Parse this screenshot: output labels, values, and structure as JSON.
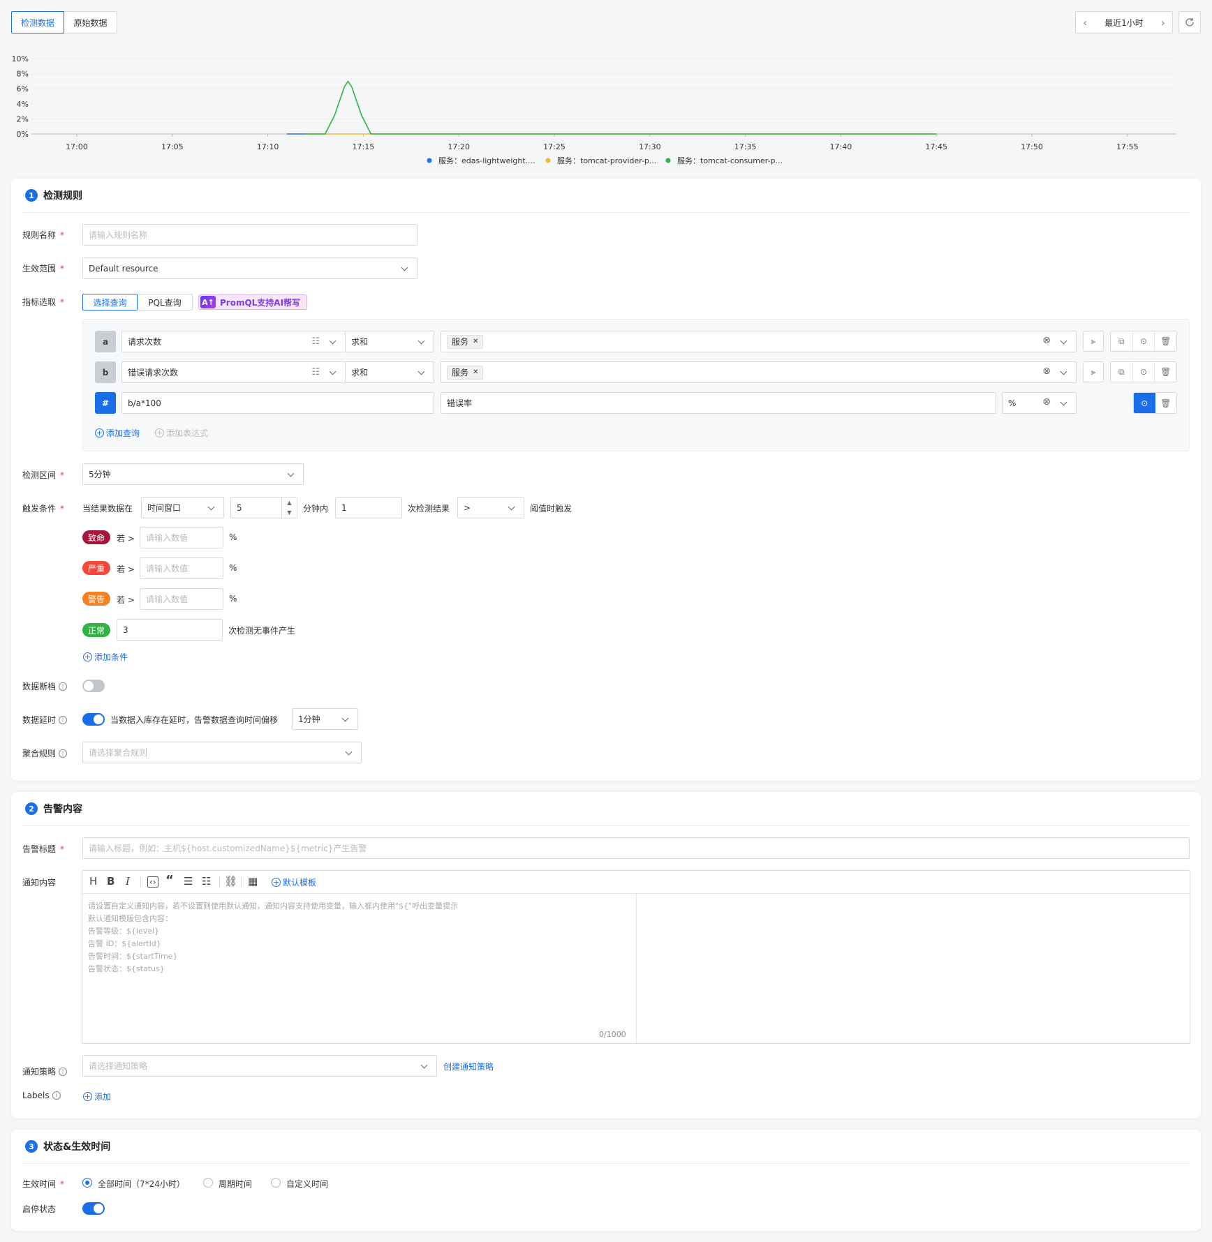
{
  "tabs": {
    "detect": "检测数据",
    "raw": "原始数据"
  },
  "timeRange": {
    "label": "最近1小时",
    "prev": "‹",
    "next": "›"
  },
  "chart_data": {
    "type": "line",
    "x": [
      "17:00",
      "17:05",
      "17:10",
      "17:15",
      "17:20",
      "17:25",
      "17:30",
      "17:35",
      "17:40",
      "17:45",
      "17:50",
      "17:55"
    ],
    "yticks": [
      "10%",
      "8%",
      "6%",
      "4%",
      "2%",
      "0%"
    ],
    "ylim": [
      0,
      10
    ],
    "series": [
      {
        "name": "服务：edas-lightweight....",
        "color": "#2b6ff2",
        "points": [
          [
            11.0,
            0
          ],
          [
            12.0,
            0
          ]
        ]
      },
      {
        "name": "服务：tomcat-provider-p...",
        "color": "#f5b82e",
        "points": [
          [
            12.0,
            0
          ],
          [
            45.0,
            0
          ]
        ]
      },
      {
        "name": "服务：tomcat-consumer-p...",
        "color": "#2fb344",
        "points": [
          [
            12.0,
            0
          ],
          [
            13.0,
            0
          ],
          [
            13.5,
            2.5
          ],
          [
            14.0,
            6.2
          ],
          [
            14.2,
            7.0
          ],
          [
            14.4,
            6.2
          ],
          [
            14.9,
            2.5
          ],
          [
            15.4,
            0
          ],
          [
            45.0,
            0
          ]
        ]
      }
    ]
  },
  "section1": {
    "num": "1",
    "title": "检测规则",
    "ruleName": {
      "label": "规则名称",
      "placeholder": "请输入规则名称"
    },
    "scope": {
      "label": "生效范围",
      "value": "Default resource"
    },
    "metric": {
      "label": "指标选取",
      "tabSelect": "选择查询",
      "tabPql": "PQL查询",
      "aiBadge": "PromQL支持AI帮写",
      "aiIcon": "A↑"
    },
    "queries": [
      {
        "letter": "a",
        "metric": "请求次数",
        "agg": "求和",
        "chip": "服务"
      },
      {
        "letter": "b",
        "metric": "错误请求次数",
        "agg": "求和",
        "chip": "服务"
      }
    ],
    "expr": {
      "letter": "#",
      "formula": "b/a*100",
      "alias": "错误率",
      "unit": "%"
    },
    "addQuery": "添加查询",
    "addExpr": "添加表达式",
    "interval": {
      "label": "检测区间",
      "value": "5分钟"
    },
    "trigger": {
      "label": "触发条件",
      "prefix": "当结果数据在",
      "window": "时间窗口",
      "minutes": "5",
      "minutesSuffix": "分钟内",
      "count": "1",
      "countSuffix": "次检测结果",
      "op": ">",
      "suffix": "阈值时触发"
    },
    "levels": [
      {
        "tag": "致命",
        "color": "#a8173b",
        "if": "若 >",
        "placeholder": "请输入数值",
        "unit": "%"
      },
      {
        "tag": "严重",
        "color": "#f5473b",
        "if": "若 >",
        "placeholder": "请输入数值",
        "unit": "%"
      },
      {
        "tag": "警告",
        "color": "#f58220",
        "if": "若 >",
        "placeholder": "请输入数值",
        "unit": "%"
      }
    ],
    "normal": {
      "tag": "正常",
      "color": "#2fb344",
      "value": "3",
      "suffix": "次检测无事件产生"
    },
    "addCondition": "添加条件",
    "dataBreak": {
      "label": "数据断档"
    },
    "dataDelay": {
      "label": "数据延时",
      "desc": "当数据入库存在延时，告警数据查询时间偏移",
      "value": "1分钟"
    },
    "aggRule": {
      "label": "聚合规则",
      "placeholder": "请选择聚合规则"
    }
  },
  "section2": {
    "num": "2",
    "title": "告警内容",
    "alertTitle": {
      "label": "告警标题",
      "placeholder": "请输入标题，例如：主机${host.customizedName}${metric}产生告警"
    },
    "notify": {
      "label": "通知内容",
      "template": "默认模板",
      "counter": "0/1000",
      "placeholderLines": [
        "请设置自定义通知内容，若不设置则使用默认通知，通知内容支持使用变量，输入框内使用\"${\"呼出变量提示",
        "默认通知模版包含内容：",
        "告警等级：${level}",
        "告警 ID：${alertId}",
        "告警时间：${startTime}",
        "告警状态：${status}"
      ]
    },
    "policy": {
      "label": "通知策略",
      "placeholder": "请选择通知策略",
      "create": "创建通知策略"
    },
    "labels": {
      "label": "Labels",
      "add": "添加"
    }
  },
  "section3": {
    "num": "3",
    "title": "状态&生效时间",
    "effectTime": {
      "label": "生效时间",
      "options": [
        "全部时间（7*24小时）",
        "周期时间",
        "自定义时间"
      ]
    },
    "status": {
      "label": "启停状态"
    }
  }
}
